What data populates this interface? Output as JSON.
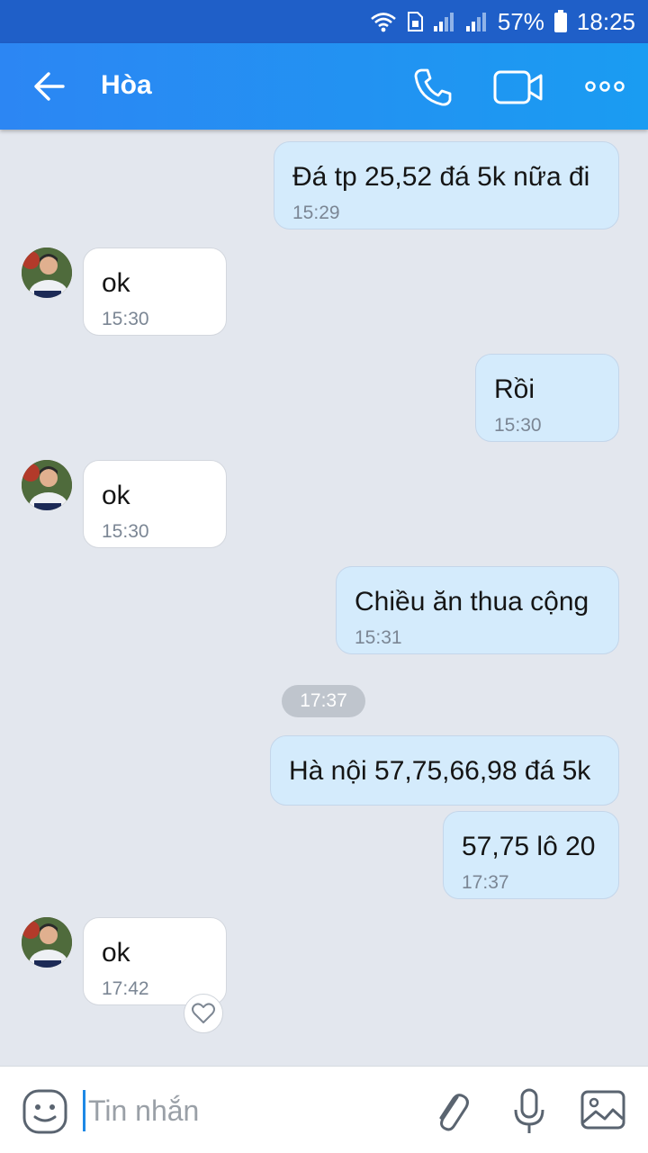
{
  "status_bar": {
    "battery": "57%",
    "time": "18:25"
  },
  "header": {
    "contact_name": "Hòa"
  },
  "messages": [
    {
      "direction": "out",
      "text": "Đá tp 25,52 đá 5k nữa đi",
      "time": "15:29"
    },
    {
      "direction": "in",
      "text": "ok",
      "time": "15:30"
    },
    {
      "direction": "out",
      "text": "Rồi",
      "time": "15:30"
    },
    {
      "direction": "in",
      "text": "ok",
      "time": "15:30"
    },
    {
      "direction": "out",
      "text": "Chiều ăn thua cộng",
      "time": "15:31"
    },
    {
      "direction": "out",
      "text": "Hà nội 57,75,66,98 đá 5k",
      "time": ""
    },
    {
      "direction": "out",
      "text": "57,75 lô 20",
      "time": "17:37"
    },
    {
      "direction": "in",
      "text": "ok",
      "time": "17:42"
    }
  ],
  "time_separator": "17:37",
  "input": {
    "placeholder": "Tin nhắn",
    "value": ""
  },
  "colors": {
    "header_start": "#2c86f3",
    "header_end": "#1a9cf2",
    "outgoing_bubble": "#d4ebfc",
    "incoming_bubble": "#ffffff",
    "chat_background": "#e3e7ee"
  }
}
